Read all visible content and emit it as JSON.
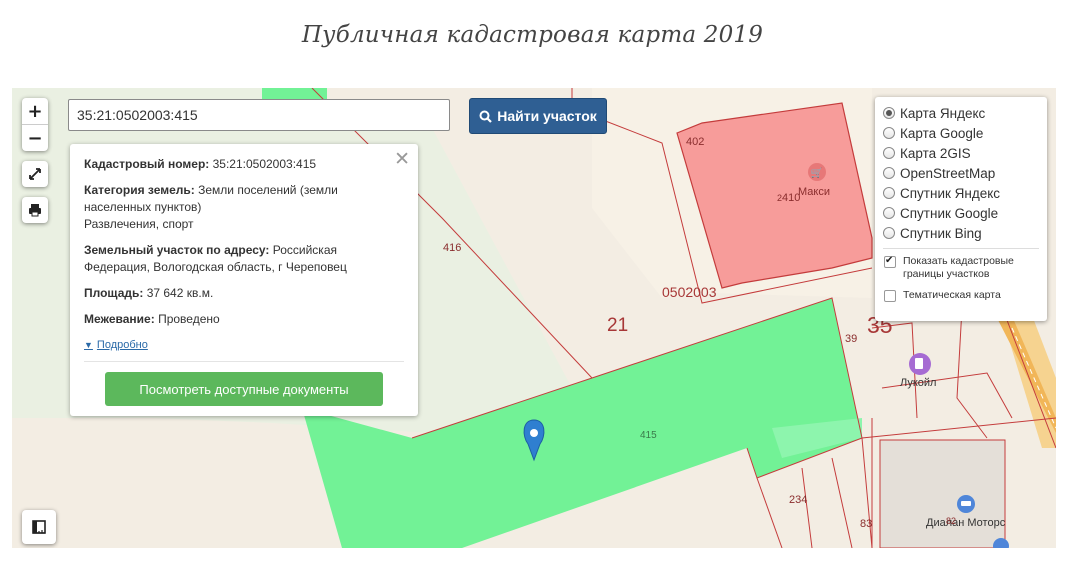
{
  "page": {
    "title": "Публичная кадастровая карта 2019"
  },
  "controls": {
    "zoom_in": "+",
    "zoom_out": "−"
  },
  "search": {
    "value": "35:21:0502003:415",
    "button_label": "Найти участок"
  },
  "info": {
    "cadastral_label": "Кадастровый номер:",
    "cadastral_value": "35:21:0502003:415",
    "category_label": "Категория земель:",
    "category_value": "Земли поселений (земли населенных пунктов)",
    "usage": "Развлечения, спорт",
    "address_label": "Земельный участок по адресу:",
    "address_value": "Российская Федерация, Вологодская область, г Череповец",
    "area_label": "Площадь:",
    "area_value": "37 642 кв.м.",
    "survey_label": "Межевание:",
    "survey_value": "Проведено",
    "more_link": "Подробно",
    "docs_button": "Посмотреть доступные документы"
  },
  "layers": {
    "base_options": [
      "Карта Яндекс",
      "Карта Google",
      "Карта 2GIS",
      "OpenStreetMap",
      "Спутник Яндекс",
      "Спутник Google",
      "Спутник Bing"
    ],
    "selected": "Карта Яндекс",
    "show_borders": "Показать кадастровые границы участков",
    "show_borders_checked": true,
    "thematic": "Тематическая карта",
    "thematic_checked": false
  },
  "map_labels": {
    "parcel_402": "402",
    "parcel_410": "410",
    "parcel_410_prefix": "2",
    "parcel_416": "416",
    "quarter": "0502003",
    "district": "21",
    "region": "35",
    "parcel_39": "39",
    "parcel_415": "415",
    "parcel_234": "234",
    "parcel_83": "83",
    "poi_maxi": "Макси",
    "poi_lukoil": "Лукойл",
    "poi_dialan": "Диалан Моторс",
    "poi_dialan_num": "82"
  },
  "colors": {
    "selected_parcel": "#72f296",
    "highlight_building": "#f79c9a",
    "border": "#c43c3c",
    "accent_button": "#2f5f93",
    "docs_button": "#5cb85c"
  }
}
